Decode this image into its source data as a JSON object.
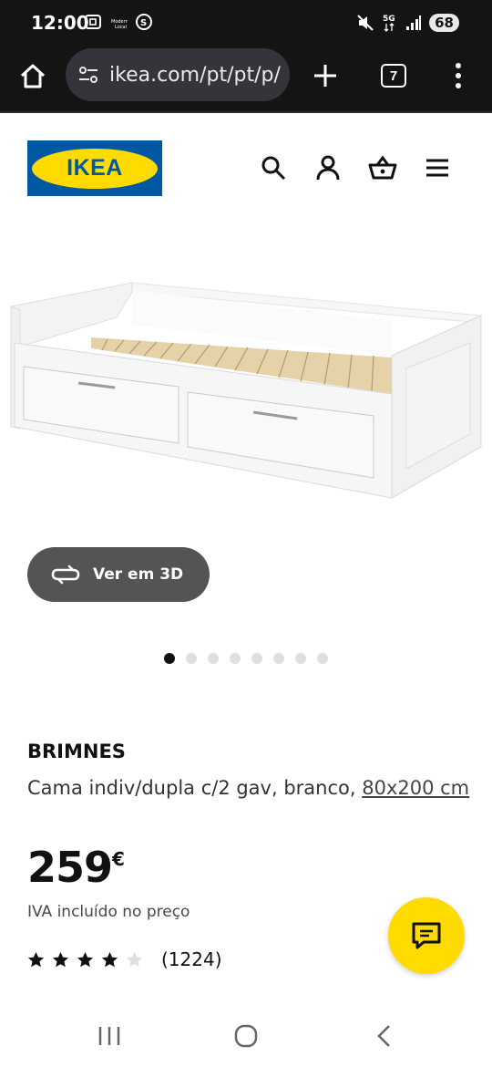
{
  "status_bar": {
    "time": "12:00",
    "network": "5G",
    "battery": "68"
  },
  "browser": {
    "url": "ikea.com/pt/pt/p/",
    "tabs_count": "7"
  },
  "header": {
    "logo_text": "IKEA"
  },
  "product": {
    "view_3d_label": "Ver em 3D",
    "name": "BRIMNES",
    "description": "Cama indiv/dupla c/2 gav, branco, ",
    "size_link": "80x200 cm",
    "price": "259",
    "currency": "€",
    "vat_note": "IVA incluído no preço",
    "rating_stars": 4,
    "rating_max": 5,
    "review_count": "(1224)"
  },
  "carousel": {
    "total": 8,
    "active_index": 0
  },
  "colors": {
    "ikea_blue": "#0058a3",
    "ikea_yellow": "#ffdb00"
  }
}
